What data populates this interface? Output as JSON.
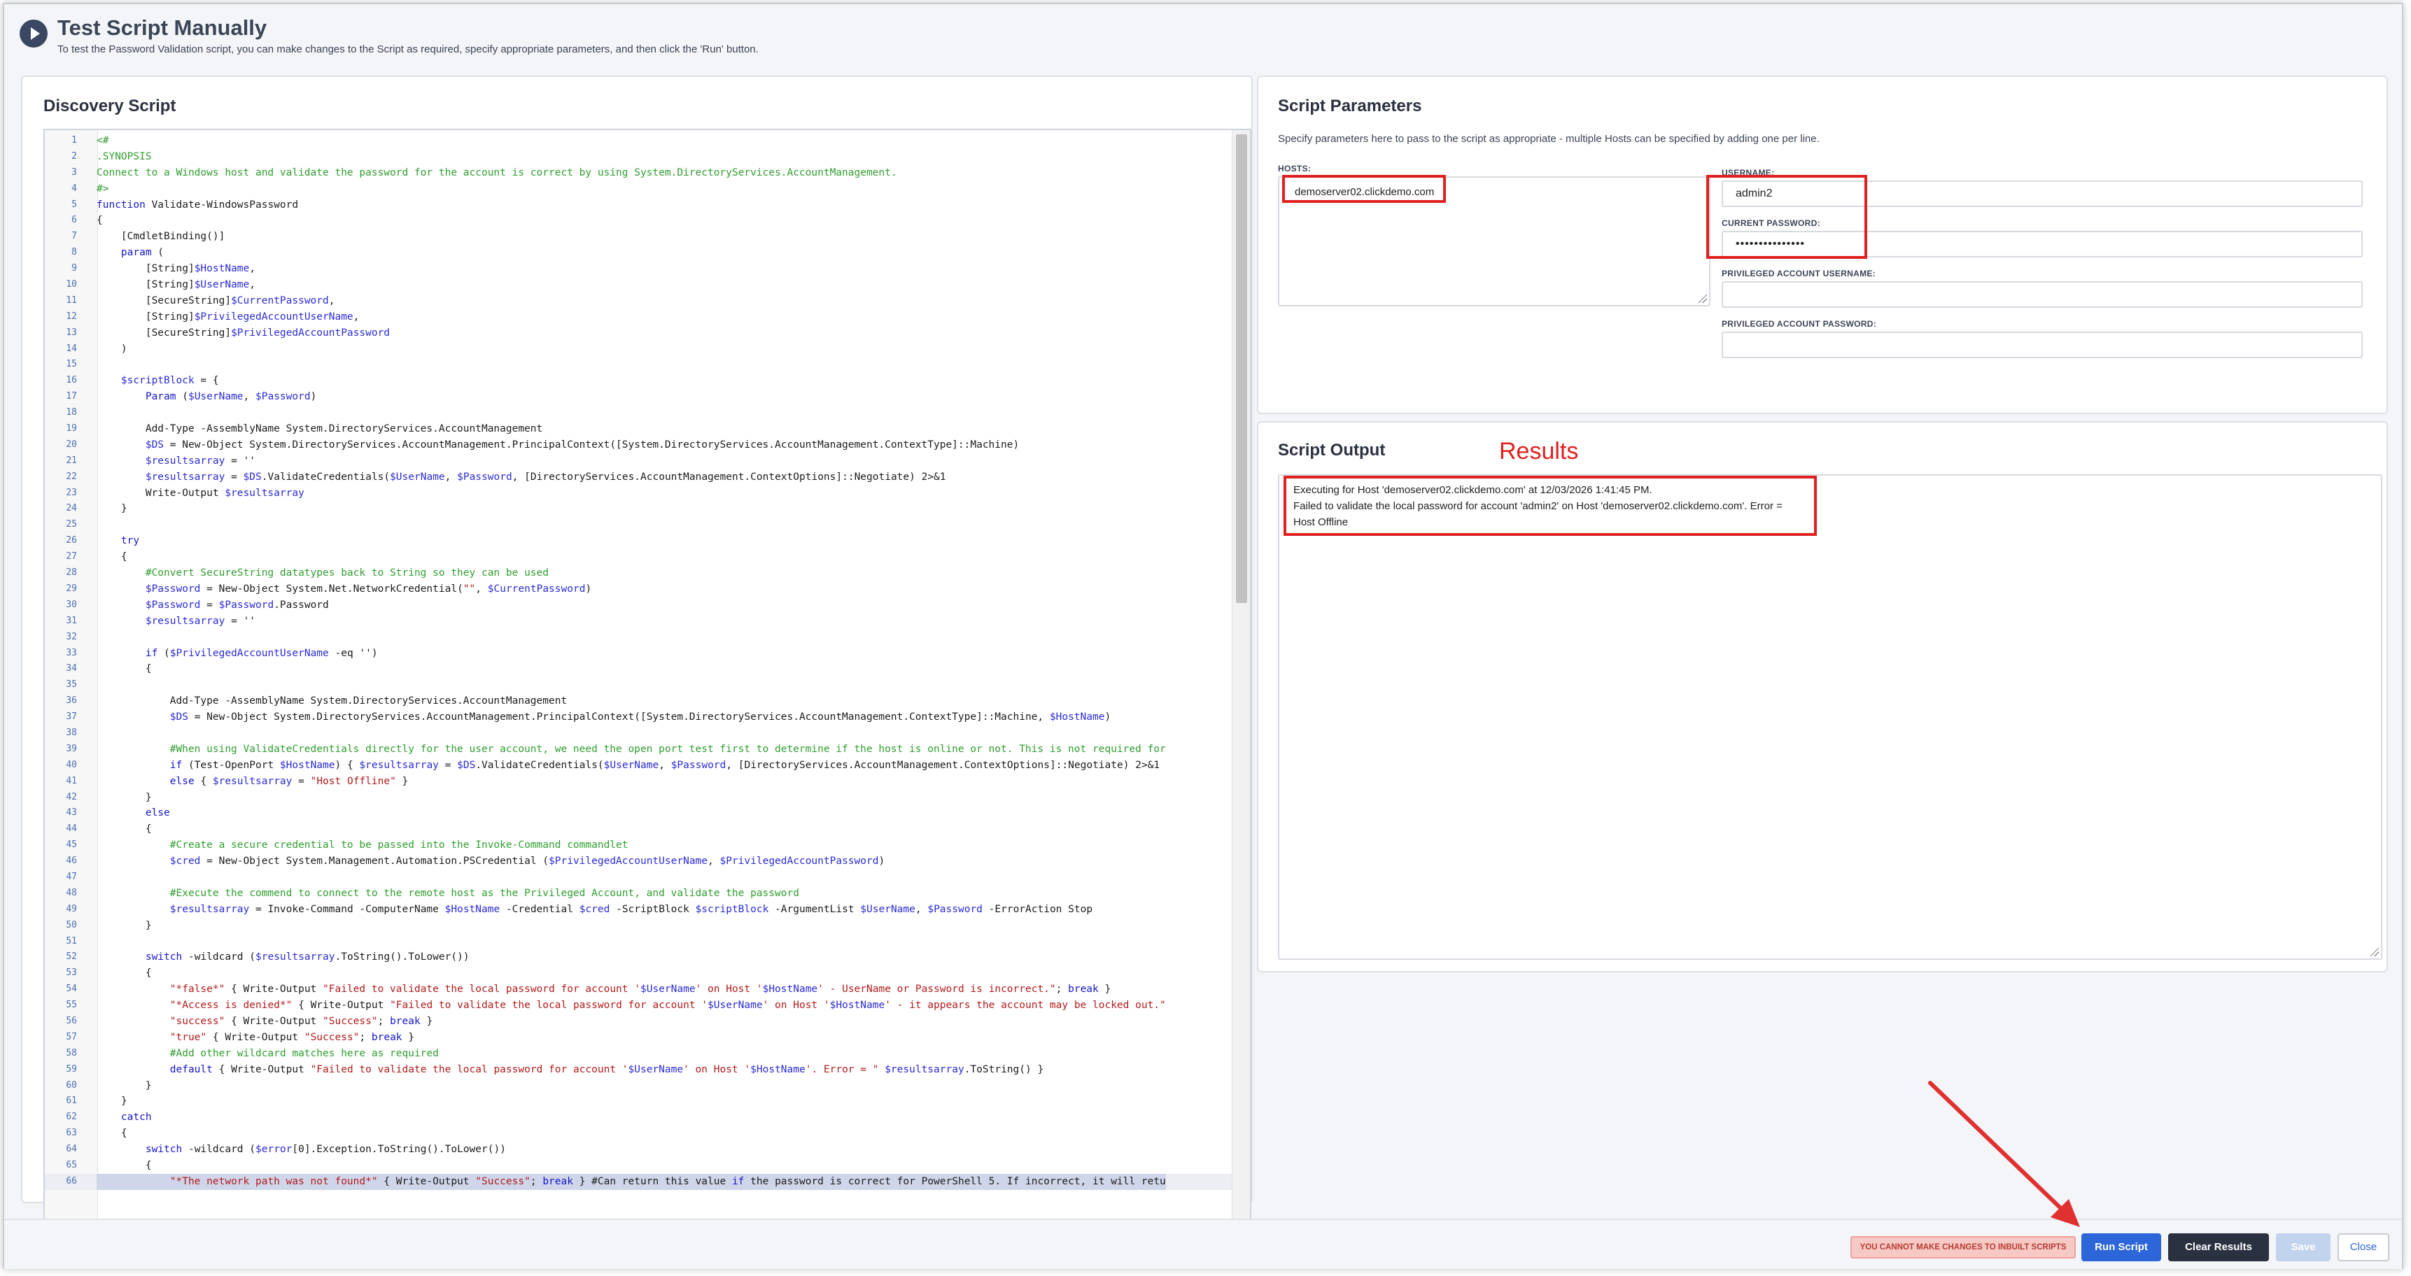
{
  "header": {
    "title": "Test Script Manually",
    "subtitle": "To test the Password Validation script, you can make changes to the Script as required, specify appropriate parameters, and then click the 'Run' button."
  },
  "discovery": {
    "title": "Discovery Script",
    "lines": [
      "<#",
      ".SYNOPSIS",
      "Connect to a Windows host and validate the password for the account is correct by using System.DirectoryServices.AccountManagement.",
      "#>",
      "function Validate-WindowsPassword",
      "{",
      "    [CmdletBinding()]",
      "    param (",
      "        [String]$HostName,",
      "        [String]$UserName,",
      "        [SecureString]$CurrentPassword,",
      "        [String]$PrivilegedAccountUserName,",
      "        [SecureString]$PrivilegedAccountPassword",
      "    )",
      "",
      "    $scriptBlock = {",
      "        Param ($UserName, $Password)",
      "",
      "        Add-Type -AssemblyName System.DirectoryServices.AccountManagement",
      "        $DS = New-Object System.DirectoryServices.AccountManagement.PrincipalContext([System.DirectoryServices.AccountManagement.ContextType]::Machine)",
      "        $resultsarray = ''",
      "        $resultsarray = $DS.ValidateCredentials($UserName, $Password, [DirectoryServices.AccountManagement.ContextOptions]::Negotiate) 2>&1",
      "        Write-Output $resultsarray",
      "    }",
      "",
      "    try",
      "    {",
      "        #Convert SecureString datatypes back to String so they can be used",
      "        $Password = New-Object System.Net.NetworkCredential(\"\", $CurrentPassword)",
      "        $Password = $Password.Password",
      "        $resultsarray = ''",
      "",
      "        if ($PrivilegedAccountUserName -eq '')",
      "        {",
      "",
      "            Add-Type -AssemblyName System.DirectoryServices.AccountManagement",
      "            $DS = New-Object System.DirectoryServices.AccountManagement.PrincipalContext([System.DirectoryServices.AccountManagement.ContextType]::Machine, $HostName)",
      "",
      "            #When using ValidateCredentials directly for the user account, we need the open port test first to determine if the host is online or not. This is not required for",
      "            if (Test-OpenPort $HostName) { $resultsarray = $DS.ValidateCredentials($UserName, $Password, [DirectoryServices.AccountManagement.ContextOptions]::Negotiate) 2>&1",
      "            else { $resultsarray = \"Host Offline\" }",
      "        }",
      "        else",
      "        {",
      "            #Create a secure credential to be passed into the Invoke-Command commandlet",
      "            $cred = New-Object System.Management.Automation.PSCredential ($PrivilegedAccountUserName, $PrivilegedAccountPassword)",
      "",
      "            #Execute the commend to connect to the remote host as the Privileged Account, and validate the password",
      "            $resultsarray = Invoke-Command -ComputerName $HostName -Credential $cred -ScriptBlock $scriptBlock -ArgumentList $UserName, $Password -ErrorAction Stop",
      "        }",
      "",
      "        switch -wildcard ($resultsarray.ToString().ToLower())",
      "        {",
      "            \"*false*\" { Write-Output \"Failed to validate the local password for account '$UserName' on Host '$HostName' - UserName or Password is incorrect.\"; break }",
      "            \"*Access is denied*\" { Write-Output \"Failed to validate the local password for account '$UserName' on Host '$HostName' - it appears the account may be locked out.\"",
      "            \"success\" { Write-Output \"Success\"; break }",
      "            \"true\" { Write-Output \"Success\"; break }",
      "            #Add other wildcard matches here as required",
      "            default { Write-Output \"Failed to validate the local password for account '$UserName' on Host '$HostName'. Error = \" $resultsarray.ToString() }",
      "        }",
      "    }",
      "    catch",
      "    {",
      "        switch -wildcard ($error[0].Exception.ToString().ToLower())",
      "        {",
      "            \"*The network path was not found*\" { Write-Output \"Success\"; break } #Can return this value if the password is correct for PowerShell 5. If incorrect, it will retu"
    ]
  },
  "params": {
    "title": "Script Parameters",
    "description": "Specify parameters here to pass to the script as appropriate - multiple Hosts can be specified by adding one per line.",
    "hosts_label": "HOSTS:",
    "hosts_value": "demoserver02.clickdemo.com",
    "username_label": "USERNAME:",
    "username_value": "admin2",
    "current_password_label": "CURRENT PASSWORD:",
    "current_password_value": "•••••••••••••••",
    "priv_username_label": "PRIVILEGED ACCOUNT USERNAME:",
    "priv_username_value": "",
    "priv_password_label": "PRIVILEGED ACCOUNT PASSWORD:",
    "priv_password_value": ""
  },
  "output": {
    "title": "Script Output",
    "annotation": "Results",
    "lines": [
      "Executing for Host 'demoserver02.clickdemo.com' at 12/03/2026 1:41:45 PM.",
      "Failed to validate the local password for account 'admin2' on Host 'demoserver02.clickdemo.com'. Error =",
      "Host Offline"
    ]
  },
  "footer": {
    "warning": "YOU CANNOT MAKE CHANGES TO INBUILT SCRIPTS",
    "run_label": "Run Script",
    "clear_label": "Clear Results",
    "save_label": "Save",
    "close_label": "Close"
  },
  "colors": {
    "primary": "#2c66d8",
    "dark_button": "#2a3140",
    "annotation_red": "#e02020",
    "comment_green": "#2f9e2f",
    "warning_bg": "#f7c9c5"
  },
  "icons": {
    "header": "play-circle-icon"
  }
}
